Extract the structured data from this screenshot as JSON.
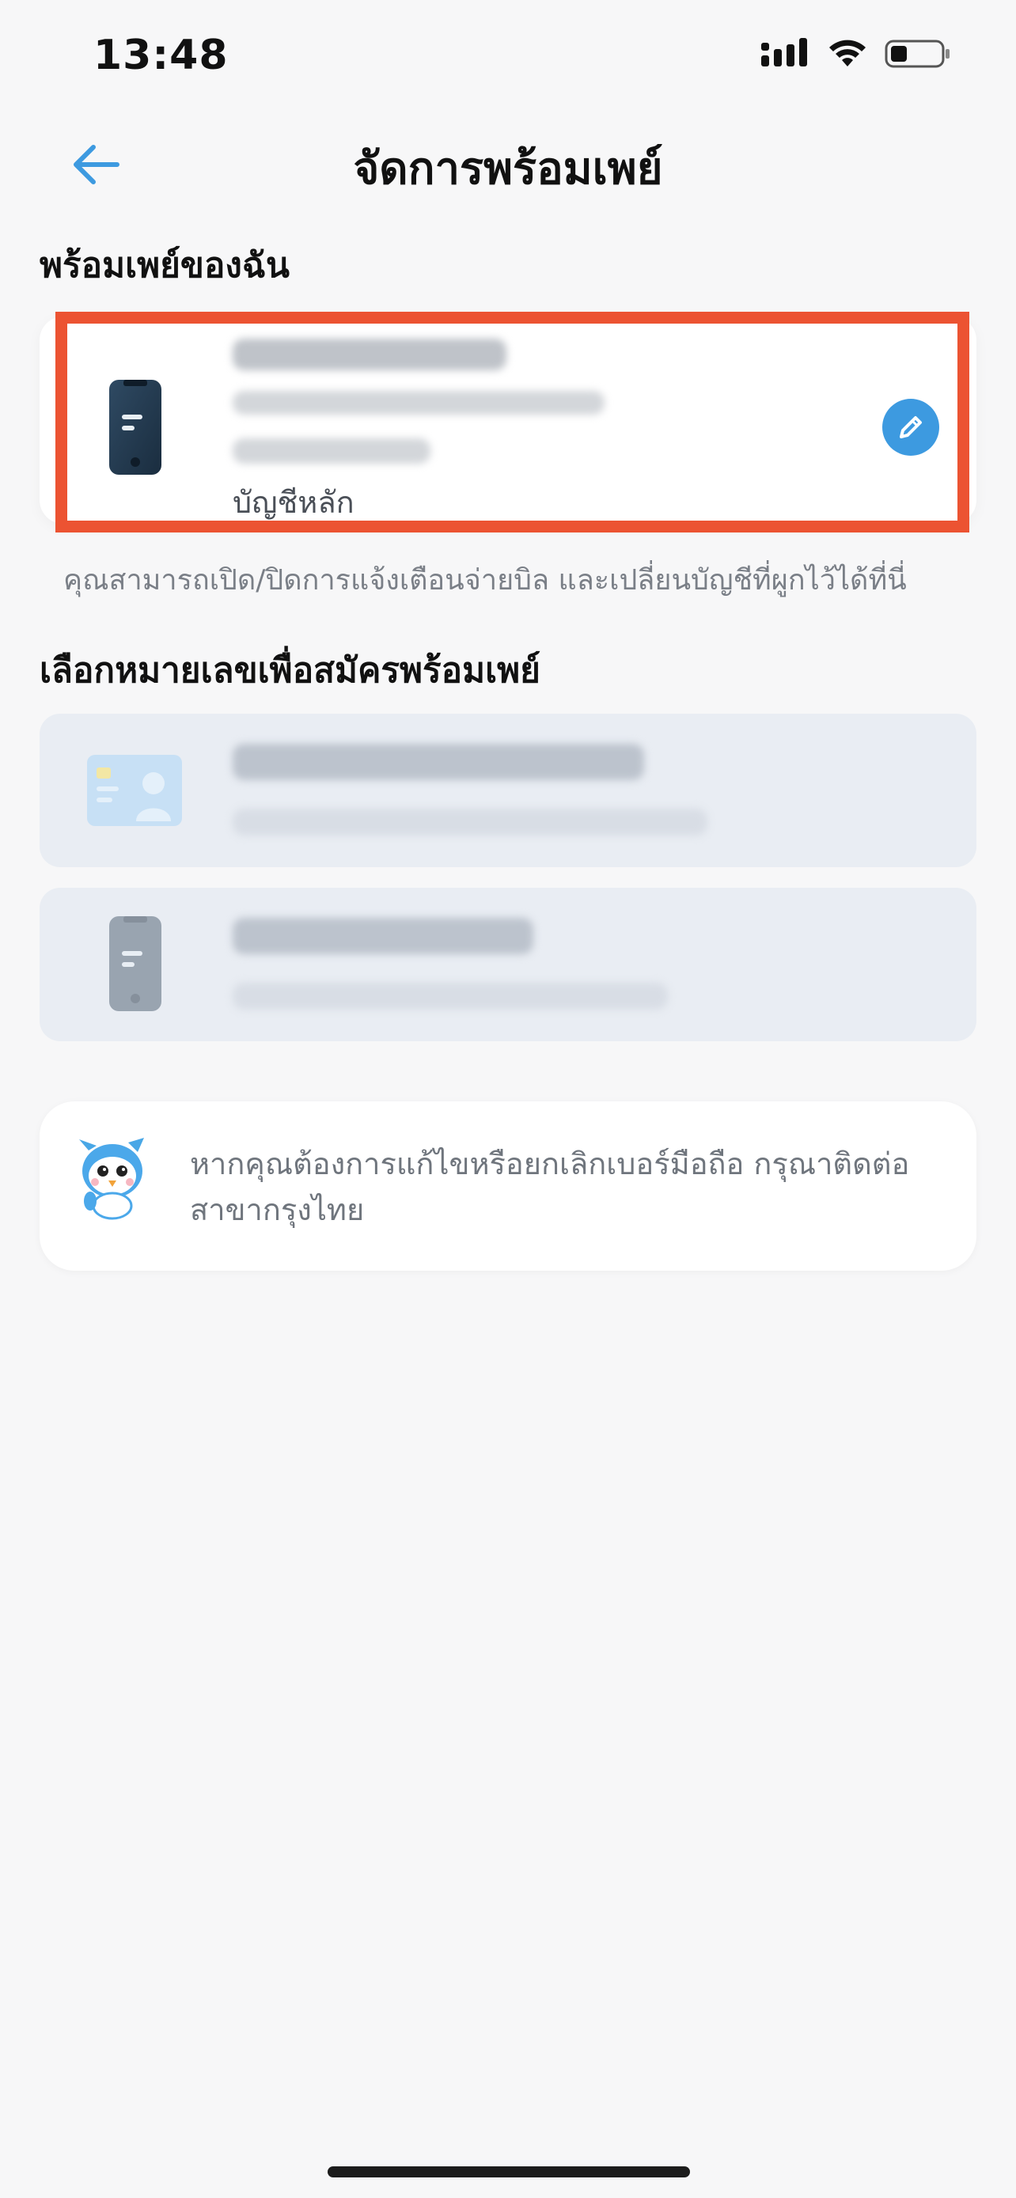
{
  "status_bar": {
    "time": "13:48"
  },
  "header": {
    "title": "จัดการพร้อมเพย์"
  },
  "my_promptpay": {
    "section_title": "พร้อมเพย์ของฉัน",
    "account_label": "บัญชีหลัก",
    "note": "คุณสามารถเปิด/ปิดการแจ้งเตือนจ่ายบิล และเปลี่ยนบัญชีที่ผูกไว้ได้ที่นี่"
  },
  "register": {
    "section_title": "เลือกหมายเลขเพื่อสมัครพร้อมเพย์"
  },
  "info": {
    "text": "หากคุณต้องการแก้ไขหรือยกเลิกเบอร์มือถือ กรุณาติดต่อสาขากรุงไทย"
  },
  "colors": {
    "accent": "#3d9ae0",
    "highlight": "#ec5332",
    "option_bg": "#e9edf3"
  }
}
